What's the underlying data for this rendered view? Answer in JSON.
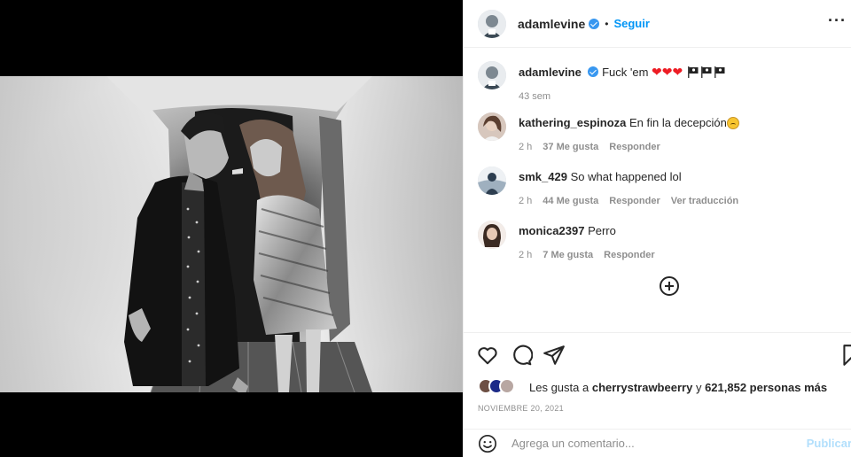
{
  "post": {
    "author": "adamlevine",
    "follow_label": "Seguir",
    "separator": "•",
    "more_label": "···"
  },
  "caption": {
    "user": "adamlevine",
    "text": "Fuck 'em",
    "emoji_hearts": "❤❤❤",
    "time": "43 sem"
  },
  "comments": [
    {
      "user": "kathering_espinoza",
      "text": "En fin la decepción",
      "time": "2 h",
      "likes": "37 Me gusta",
      "reply": "Responder",
      "translate": ""
    },
    {
      "user": "smk_429",
      "text": "So what happened lol",
      "time": "2 h",
      "likes": "44 Me gusta",
      "reply": "Responder",
      "translate": "Ver traducción"
    },
    {
      "user": "monica2397",
      "text": "Perro",
      "time": "2 h",
      "likes": "7 Me gusta",
      "reply": "Responder",
      "translate": ""
    }
  ],
  "likes": {
    "prefix": "Les gusta a",
    "user": "cherrystrawbeerry",
    "middle": "y",
    "count": "621,852 personas más"
  },
  "date": "NOVIEMBRE 20, 2021",
  "add_comment": {
    "placeholder": "Agrega un comentario...",
    "publish": "Publicar"
  },
  "icons": [
    "heart-icon",
    "comment-icon",
    "share-icon",
    "bookmark-icon",
    "plus-circle-icon",
    "smile-icon",
    "verified-icon",
    "more-icon"
  ],
  "colors": {
    "accent": "#0095f6",
    "verified": "#3897f0",
    "muted": "#8e8e8e",
    "publish_disabled": "#b2dffc"
  }
}
